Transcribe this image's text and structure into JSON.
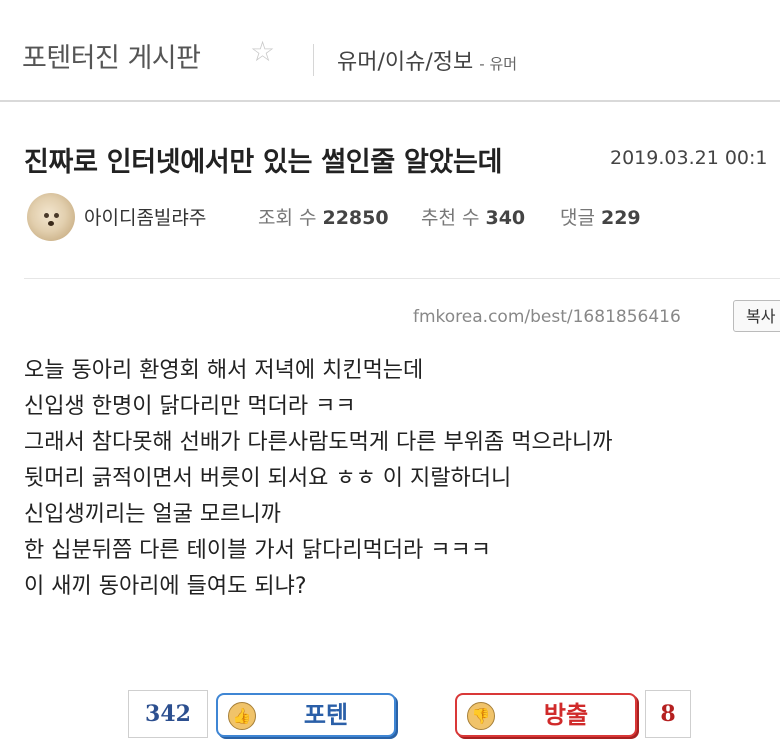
{
  "header": {
    "board_name": "포텐터진 게시판",
    "category": "유머/이슈/정보",
    "subcategory": "- 유머"
  },
  "post": {
    "title": "진짜로 인터넷에서만 있는 썰인줄 알았는데",
    "date": "2019.03.21 00:1",
    "author": "아이디좀빌랴주",
    "views_label": "조회 수",
    "views": "22850",
    "recommend_label": "추천 수",
    "recommend": "340",
    "comments_label": "댓글",
    "comments": "229",
    "url": "fmkorea.com/best/1681856416",
    "copy_label": "복사",
    "body_lines": [
      "오늘 동아리 환영회 해서 저녁에 치킨먹는데",
      "신입생 한명이 닭다리만 먹더라 ㅋㅋ",
      "그래서 참다못해 선배가 다른사람도먹게 다른 부위좀 먹으라니까",
      "뒷머리 긁적이면서 버릇이 되서요 ㅎㅎ 이 지랄하더니",
      "신입생끼리는 얼굴 모르니까",
      "한 십분뒤쯤 다른 테이블 가서 닭다리먹더라 ㅋㅋㅋ",
      "이 새끼 동아리에 들여도 되냐?"
    ]
  },
  "voting": {
    "up_count": "342",
    "up_label": "포텐",
    "down_label": "방출",
    "down_count": "8"
  },
  "icons": {
    "star": "star-outline-icon",
    "vote_up": "thumbs-up-face-icon",
    "vote_down": "thumbs-down-face-icon"
  },
  "colors": {
    "vote_up_border": "#3f86d4",
    "vote_down_border": "#d93838",
    "up_count_text": "#2c4f8f",
    "down_count_text": "#b52020"
  }
}
